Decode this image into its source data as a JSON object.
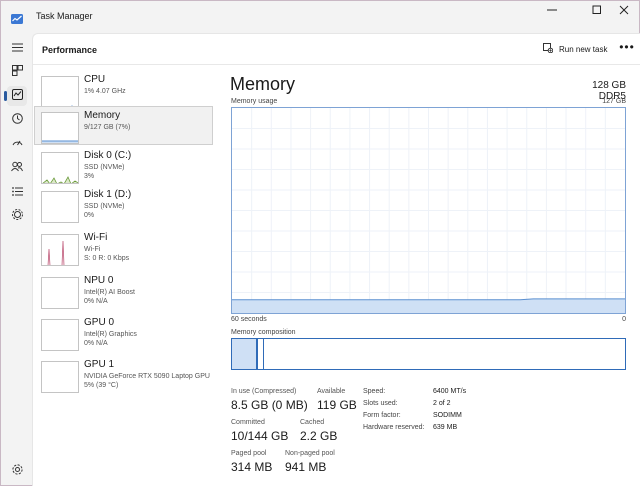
{
  "window": {
    "title": "Task Manager"
  },
  "icons": {
    "app": "task-manager-icon",
    "minimize": "minimize-icon",
    "maximize": "maximize-icon",
    "close": "close-icon",
    "nav": [
      "hamburger-icon",
      "processes-icon",
      "performance-icon",
      "app-history-icon",
      "startup-icon",
      "users-icon",
      "details-icon",
      "services-icon",
      "settings-icon"
    ],
    "run_task": "run-task-icon"
  },
  "header": {
    "page_title": "Performance",
    "run_task_label": "Run new task",
    "more_label": "•••"
  },
  "resources": [
    {
      "name": "CPU",
      "sub1": "1%  4.07 GHz",
      "sub2": ""
    },
    {
      "name": "Memory",
      "sub1": "9/127 GB (7%)",
      "sub2": ""
    },
    {
      "name": "Disk 0 (C:)",
      "sub1": "SSD (NVMe)",
      "sub2": "3%"
    },
    {
      "name": "Disk 1 (D:)",
      "sub1": "SSD (NVMe)",
      "sub2": "0%"
    },
    {
      "name": "Wi-Fi",
      "sub1": "Wi-Fi",
      "sub2": "S: 0  R: 0 Kbps"
    },
    {
      "name": "NPU 0",
      "sub1": "Intel(R) AI Boost",
      "sub2": "0%  N/A"
    },
    {
      "name": "GPU 0",
      "sub1": "Intel(R) Graphics",
      "sub2": "0%  N/A"
    },
    {
      "name": "GPU 1",
      "sub1": "NVIDIA GeForce RTX 5090 Laptop GPU",
      "sub2": "5%  (39 °C)"
    }
  ],
  "memory": {
    "title": "Memory",
    "spec": "128 GB DDR5",
    "usage_label": "Memory usage",
    "usage_max": "127 GB",
    "time_left": "60 seconds",
    "time_right": "0",
    "composition_label": "Memory composition",
    "in_use_fraction": 0.066,
    "stats": [
      {
        "label": "In use (Compressed)",
        "value": "8.5 GB (0 MB)"
      },
      {
        "label": "Available",
        "value": "119 GB"
      },
      {
        "label": "Committed",
        "value": "10/144 GB"
      },
      {
        "label": "Cached",
        "value": "2.2 GB"
      },
      {
        "label": "Paged pool",
        "value": "314 MB"
      },
      {
        "label": "Non-paged pool",
        "value": "941 MB"
      }
    ],
    "specs": [
      {
        "label": "Speed:",
        "value": "6400 MT/s"
      },
      {
        "label": "Slots used:",
        "value": "2 of 2"
      },
      {
        "label": "Form factor:",
        "value": "SODIMM"
      },
      {
        "label": "Hardware reserved:",
        "value": "639 MB"
      }
    ]
  },
  "colors": {
    "accent": "#2a5a9f",
    "memory_line": "#5a8fd0",
    "memory_fill": "#cfe0f5",
    "disk": "#6a9a3a",
    "wifi": "#c05a7a"
  }
}
